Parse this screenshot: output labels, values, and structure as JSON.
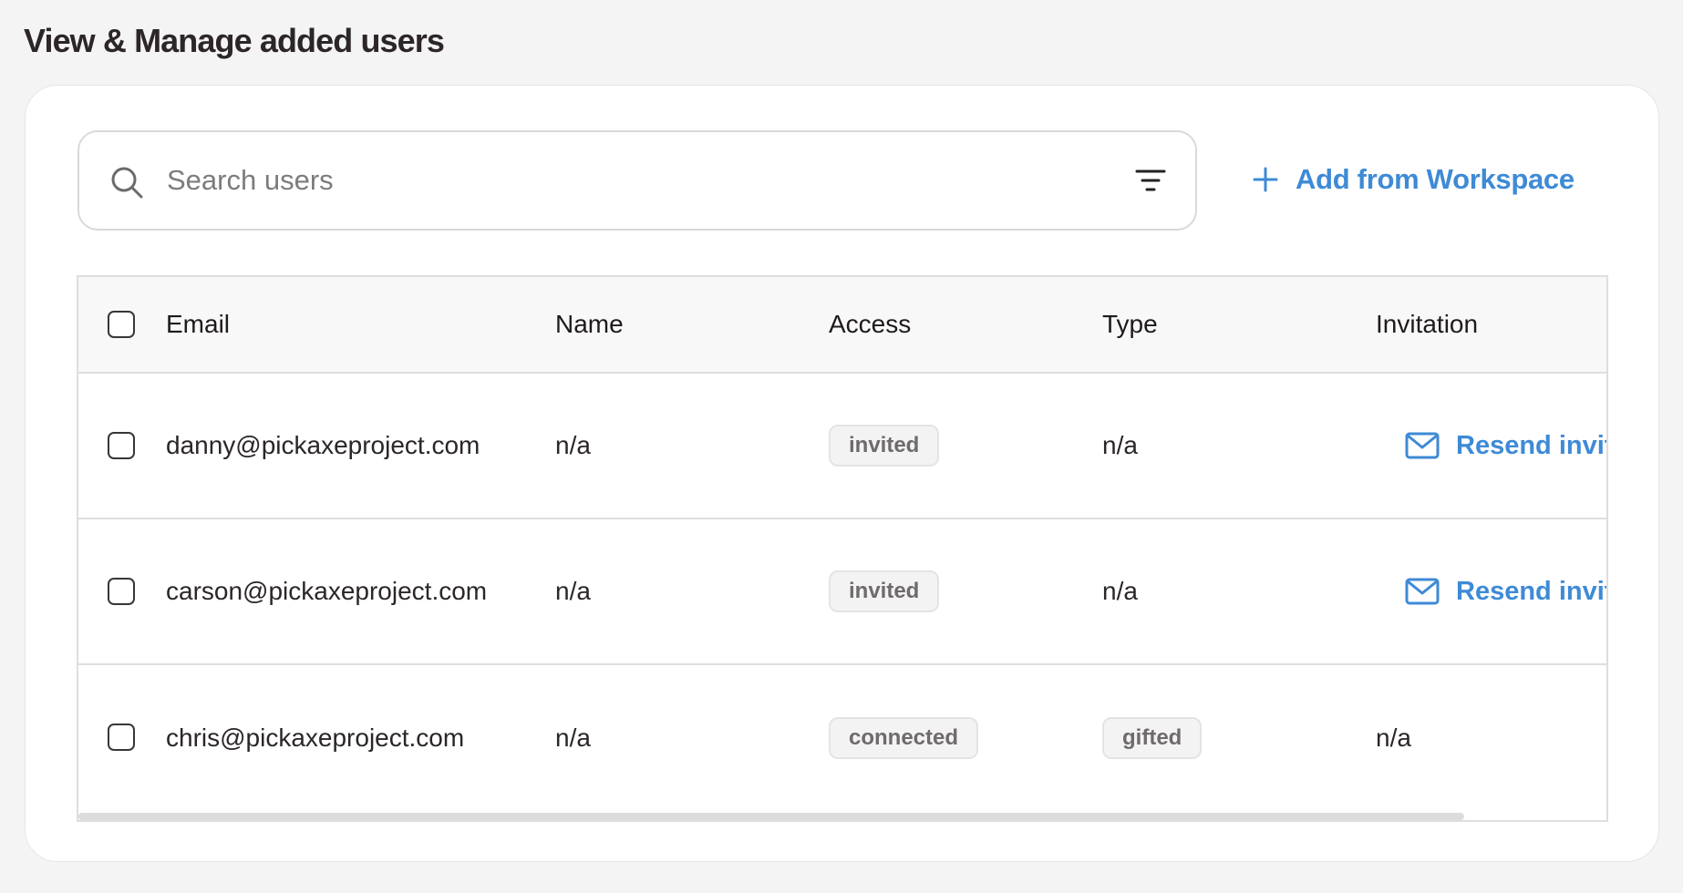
{
  "page": {
    "title": "View & Manage added users"
  },
  "search": {
    "placeholder": "Search users",
    "value": ""
  },
  "actions": {
    "add_from_workspace": "Add from Workspace"
  },
  "table": {
    "headers": {
      "email": "Email",
      "name": "Name",
      "access": "Access",
      "type": "Type",
      "invitation": "Invitation"
    },
    "rows": [
      {
        "email": "danny@pickaxeproject.com",
        "name": "n/a",
        "access": "invited",
        "type": "n/a",
        "invitation": "Resend invita"
      },
      {
        "email": "carson@pickaxeproject.com",
        "name": "n/a",
        "access": "invited",
        "type": "n/a",
        "invitation": "Resend invita"
      },
      {
        "email": "chris@pickaxeproject.com",
        "name": "n/a",
        "access": "connected",
        "type": "gifted",
        "invitation": "n/a"
      }
    ]
  },
  "icons": {
    "search": "search-icon",
    "filter": "filter-icon",
    "add": "plus-icon",
    "resend": "mail-icon"
  },
  "colors": {
    "accent": "#3e8ad6",
    "background": "#f4f4f4",
    "card": "#ffffff",
    "badge_bg": "#f3f3f3"
  }
}
